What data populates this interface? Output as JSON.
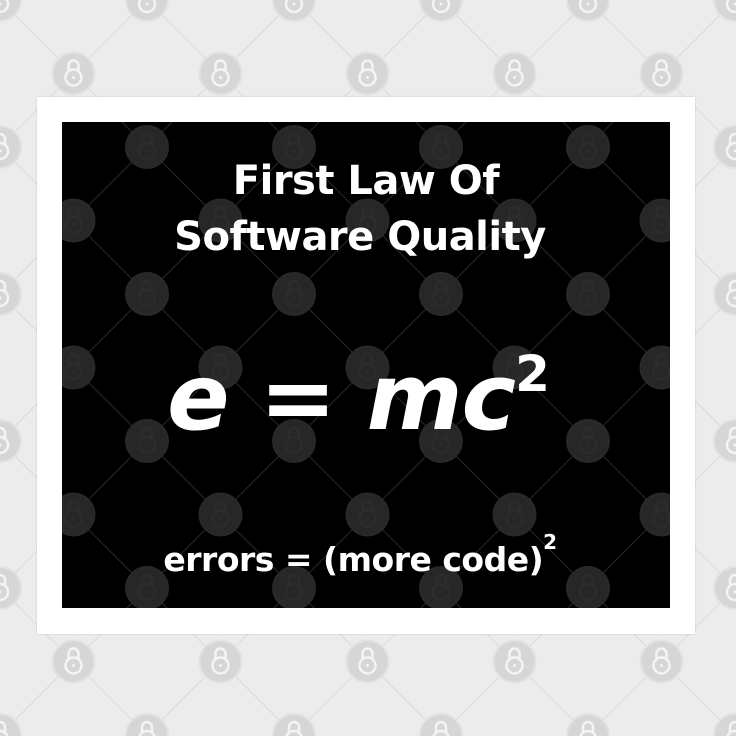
{
  "poster": {
    "title_line1": "First Law Of",
    "title_line2": "Software Quality",
    "equation_base": "e = mc",
    "equation_exponent": "2",
    "footer_base": "errors = (more code)",
    "footer_exponent": "2"
  },
  "watermark": {
    "icon": "lock-icon"
  },
  "colors": {
    "background": "#ececec",
    "frame": "#ffffff",
    "board": "#000000",
    "text": "#ffffff"
  }
}
